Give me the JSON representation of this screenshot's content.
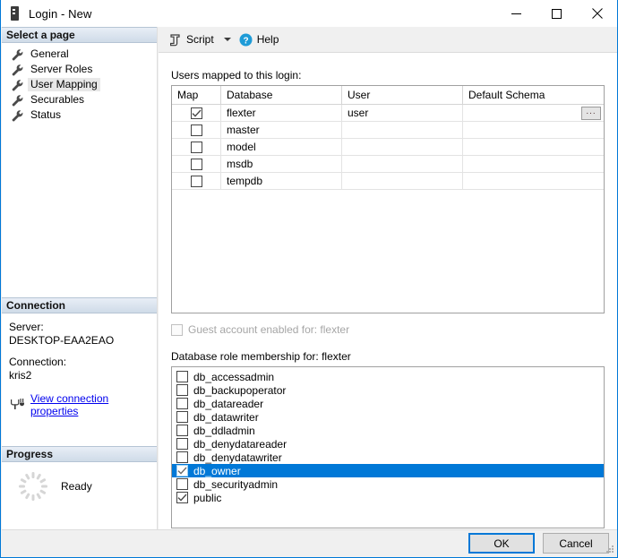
{
  "window": {
    "title": "Login - New",
    "icon": "server-icon",
    "minimize_label": "Minimize",
    "maximize_label": "Maximize",
    "close_label": "Close"
  },
  "sidebar": {
    "select_page_header": "Select a page",
    "pages": [
      {
        "label": "General",
        "icon": "wrench-icon",
        "selected": false
      },
      {
        "label": "Server Roles",
        "icon": "wrench-icon",
        "selected": false
      },
      {
        "label": "User Mapping",
        "icon": "wrench-icon",
        "selected": true
      },
      {
        "label": "Securables",
        "icon": "wrench-icon",
        "selected": false
      },
      {
        "label": "Status",
        "icon": "wrench-icon",
        "selected": false
      }
    ],
    "connection": {
      "header": "Connection",
      "server_label": "Server:",
      "server_value": "DESKTOP-EAA2EAO",
      "connection_label": "Connection:",
      "connection_value": "kris2",
      "link_text": "View connection properties",
      "link_icon": "connection-plug-icon"
    },
    "progress": {
      "header": "Progress",
      "status": "Ready",
      "icon": "spinner-icon"
    }
  },
  "toolbar": {
    "script_label": "Script",
    "script_icon": "script-icon",
    "dropdown_icon": "chevron-down-icon",
    "help_label": "Help",
    "help_icon": "help-circle-icon"
  },
  "main": {
    "users_label": "Users mapped to this login:",
    "grid": {
      "columns": [
        "Map",
        "Database",
        "User",
        "Default Schema"
      ],
      "rows": [
        {
          "map": true,
          "database": "flexter",
          "user": "user",
          "schema": "",
          "has_browse": true,
          "browse_label": "..."
        },
        {
          "map": false,
          "database": "master",
          "user": "",
          "schema": "",
          "has_browse": false
        },
        {
          "map": false,
          "database": "model",
          "user": "",
          "schema": "",
          "has_browse": false
        },
        {
          "map": false,
          "database": "msdb",
          "user": "",
          "schema": "",
          "has_browse": false
        },
        {
          "map": false,
          "database": "tempdb",
          "user": "",
          "schema": "",
          "has_browse": false
        }
      ]
    },
    "guest": {
      "label": "Guest account enabled for: flexter",
      "checked": false,
      "disabled": true
    },
    "roles_label": "Database role membership for: flexter",
    "roles": [
      {
        "label": "db_accessadmin",
        "checked": false,
        "selected": false
      },
      {
        "label": "db_backupoperator",
        "checked": false,
        "selected": false
      },
      {
        "label": "db_datareader",
        "checked": false,
        "selected": false
      },
      {
        "label": "db_datawriter",
        "checked": false,
        "selected": false
      },
      {
        "label": "db_ddladmin",
        "checked": false,
        "selected": false
      },
      {
        "label": "db_denydatareader",
        "checked": false,
        "selected": false
      },
      {
        "label": "db_denydatawriter",
        "checked": false,
        "selected": false
      },
      {
        "label": "db_owner",
        "checked": true,
        "selected": true
      },
      {
        "label": "db_securityadmin",
        "checked": false,
        "selected": false
      },
      {
        "label": "public",
        "checked": true,
        "selected": false
      }
    ]
  },
  "footer": {
    "ok_label": "OK",
    "cancel_label": "Cancel"
  },
  "colors": {
    "accent": "#0078d7",
    "link": "#0000ee",
    "section_header_bg": "#cfdbe8",
    "selection_bg": "#0078d7"
  }
}
